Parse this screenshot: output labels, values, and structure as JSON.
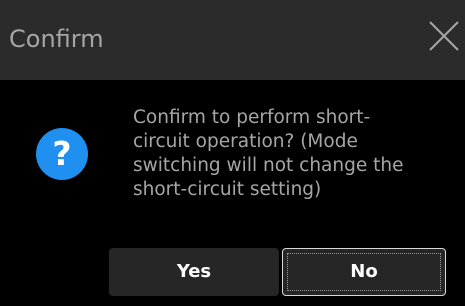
{
  "dialog": {
    "title": "Confirm",
    "close_icon": "close-icon",
    "question_icon": "question-icon",
    "question_glyph": "?",
    "message_lines": [
      "Confirm to perform short-",
      "circuit operation? (Mode",
      "switching will not change the",
      "short-circuit setting)"
    ],
    "buttons": {
      "yes_label": "Yes",
      "no_label": "No"
    }
  },
  "colors": {
    "title_bar": "#2b2b2b",
    "background": "#000000",
    "text_muted": "#a6a6a6",
    "accent_icon": "#1f8ff0",
    "button_bg": "#262626",
    "button_text": "#ffffff"
  }
}
